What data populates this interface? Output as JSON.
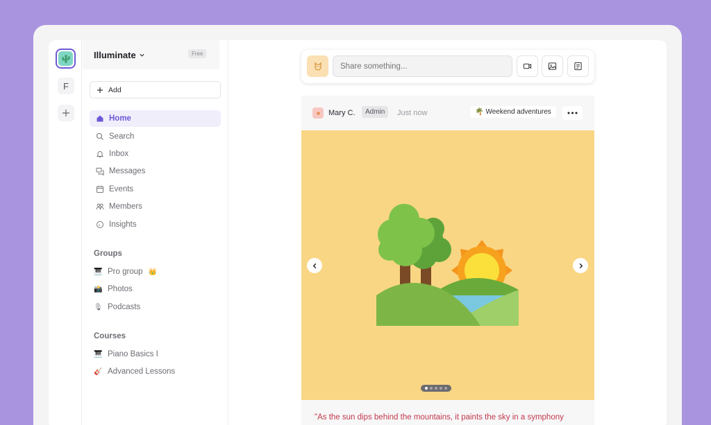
{
  "workspace": {
    "name": "Illuminate",
    "plan_badge": "Free"
  },
  "rail": {
    "items": [
      {
        "label": "F"
      }
    ]
  },
  "sidebar": {
    "add_label": "Add",
    "nav": [
      {
        "label": "Home",
        "icon": "home-icon",
        "active": true
      },
      {
        "label": "Search",
        "icon": "search-icon"
      },
      {
        "label": "Inbox",
        "icon": "bell-icon"
      },
      {
        "label": "Messages",
        "icon": "chat-icon"
      },
      {
        "label": "Events",
        "icon": "calendar-icon"
      },
      {
        "label": "Members",
        "icon": "members-icon"
      },
      {
        "label": "Insights",
        "icon": "gauge-icon"
      }
    ],
    "groups_title": "Groups",
    "groups": [
      {
        "emoji": "🎹",
        "label": "Pro group",
        "badge": "👑"
      },
      {
        "emoji": "📸",
        "label": "Photos"
      },
      {
        "emoji": "🎙",
        "label": "Podcasts"
      }
    ],
    "courses_title": "Courses",
    "courses": [
      {
        "emoji": "🎹",
        "label": "Piano Basics I"
      },
      {
        "emoji": "🎸",
        "label": "Advanced Lessons"
      }
    ]
  },
  "composer": {
    "placeholder": "Share something..."
  },
  "post": {
    "author": "Mary C.",
    "role_badge": "Admin",
    "timestamp": "Just now",
    "topic_emoji": "🌴",
    "topic": "Weekend adventures",
    "caption": "\"As the sun dips behind the mountains, it paints the sky in a symphony",
    "slides": 5,
    "current_slide": 1
  },
  "colors": {
    "accent": "#6b5ad6",
    "background": "#a994df",
    "media_bg": "#f9d684",
    "caption": "#c0394b"
  }
}
